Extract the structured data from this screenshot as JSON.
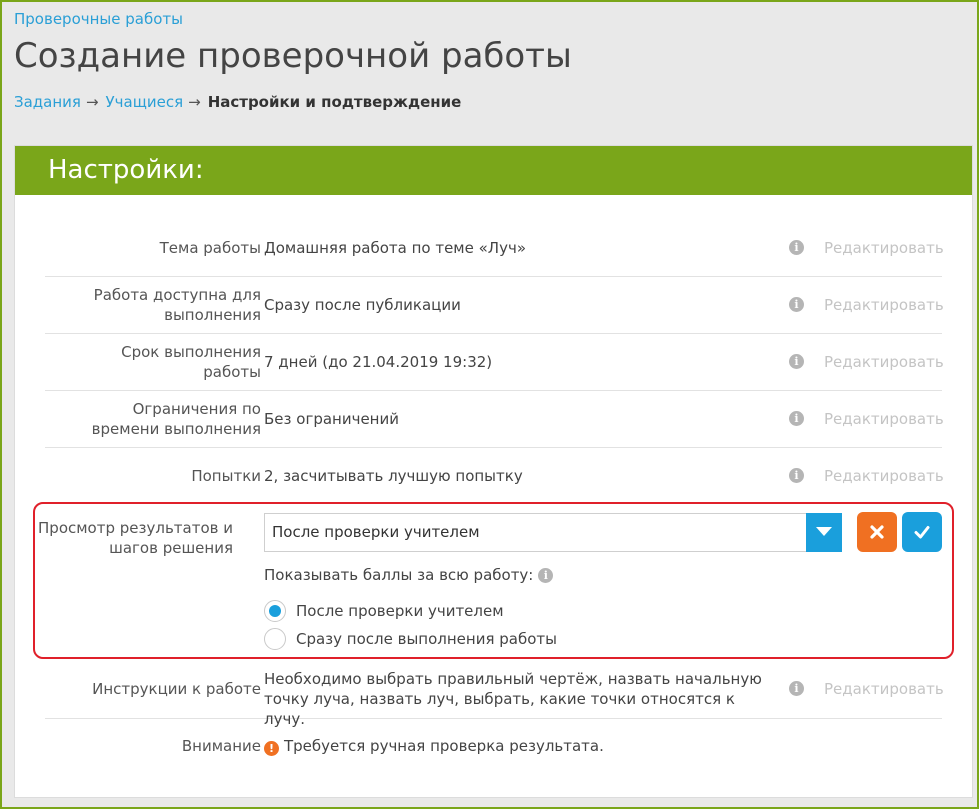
{
  "header": {
    "top_link": "Проверочные работы",
    "title": "Создание проверочной работы",
    "breadcrumb": {
      "step1": "Задания",
      "step2": "Учащиеся",
      "arrow": "→",
      "current": "Настройки и подтверждение"
    }
  },
  "panel": {
    "title": "Настройки:",
    "edit_label": "Редактировать",
    "info_glyph": "i",
    "rows": [
      {
        "label": "Тема работы",
        "value": "Домашняя работа по теме «Луч»"
      },
      {
        "label": "Работа доступна для выполнения",
        "value": "Сразу после публикации"
      },
      {
        "label": "Срок выполнения работы",
        "value": "7 дней (до 21.04.2019 19:32)"
      },
      {
        "label": "Ограничения по времени выполнения",
        "value": "Без ограничений"
      },
      {
        "label": "Попытки",
        "value": "2, засчитывать лучшую попытку"
      }
    ],
    "results_view": {
      "label": "Просмотр результатов и шагов решения",
      "selected": "После проверки учителем",
      "scores_label": "Показывать баллы за всю работу:",
      "options": [
        {
          "label": "После проверки учителем",
          "checked": true
        },
        {
          "label": "Сразу после выполнения работы",
          "checked": false
        }
      ]
    },
    "instructions": {
      "label": "Инструкции к работе",
      "value": "Необходимо выбрать правильный чертёж, назвать начальную точку луча, назвать луч, выбрать, какие точки относятся к лучу."
    },
    "attention": {
      "label": "Внимание",
      "value": "Требуется ручная проверка результата.",
      "icon_glyph": "!"
    }
  },
  "colors": {
    "accent_green": "#7aa61a",
    "link_blue": "#2a9fd6",
    "button_blue": "#1a9fdc",
    "button_orange": "#f07022",
    "highlight_red": "#e0202a"
  }
}
